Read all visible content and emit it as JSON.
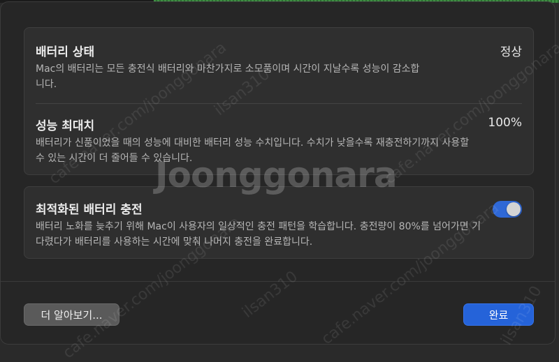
{
  "battery_health": {
    "title": "배터리 상태",
    "value": "정상",
    "description": "Mac의 배터리는 모든 충전식 배터리와 마찬가지로 소모품이며 시간이 지날수록 성능이 감소합니다."
  },
  "max_capacity": {
    "title": "성능 최대치",
    "value": "100%",
    "description": "배터리가 신품이었을 때의 성능에 대비한 배터리 성능 수치입니다. 수치가 낮을수록 재충전하기까지 사용할 수 있는 시간이 더 줄어들 수 있습니다."
  },
  "optimized_charging": {
    "title": "최적화된 배터리 충전",
    "enabled": true,
    "description": "배터리 노화를 늦추기 위해 Mac이 사용자의 일상적인 충전 패턴을 학습합니다. 충전량이 80%를 넘어가면 기다렸다가 배터리를 사용하는 시간에 맞춰 나머지 충전을 완료합니다."
  },
  "buttons": {
    "learn_more": "더 알아보기...",
    "done": "완료"
  },
  "colors": {
    "accent": "#2563d9",
    "toggle_on": "#2f68d6",
    "background": "#262626"
  },
  "watermark": {
    "logo": "Joonggonara",
    "url": "cafe.naver.com/joonggonara",
    "user": "ilsan310"
  }
}
